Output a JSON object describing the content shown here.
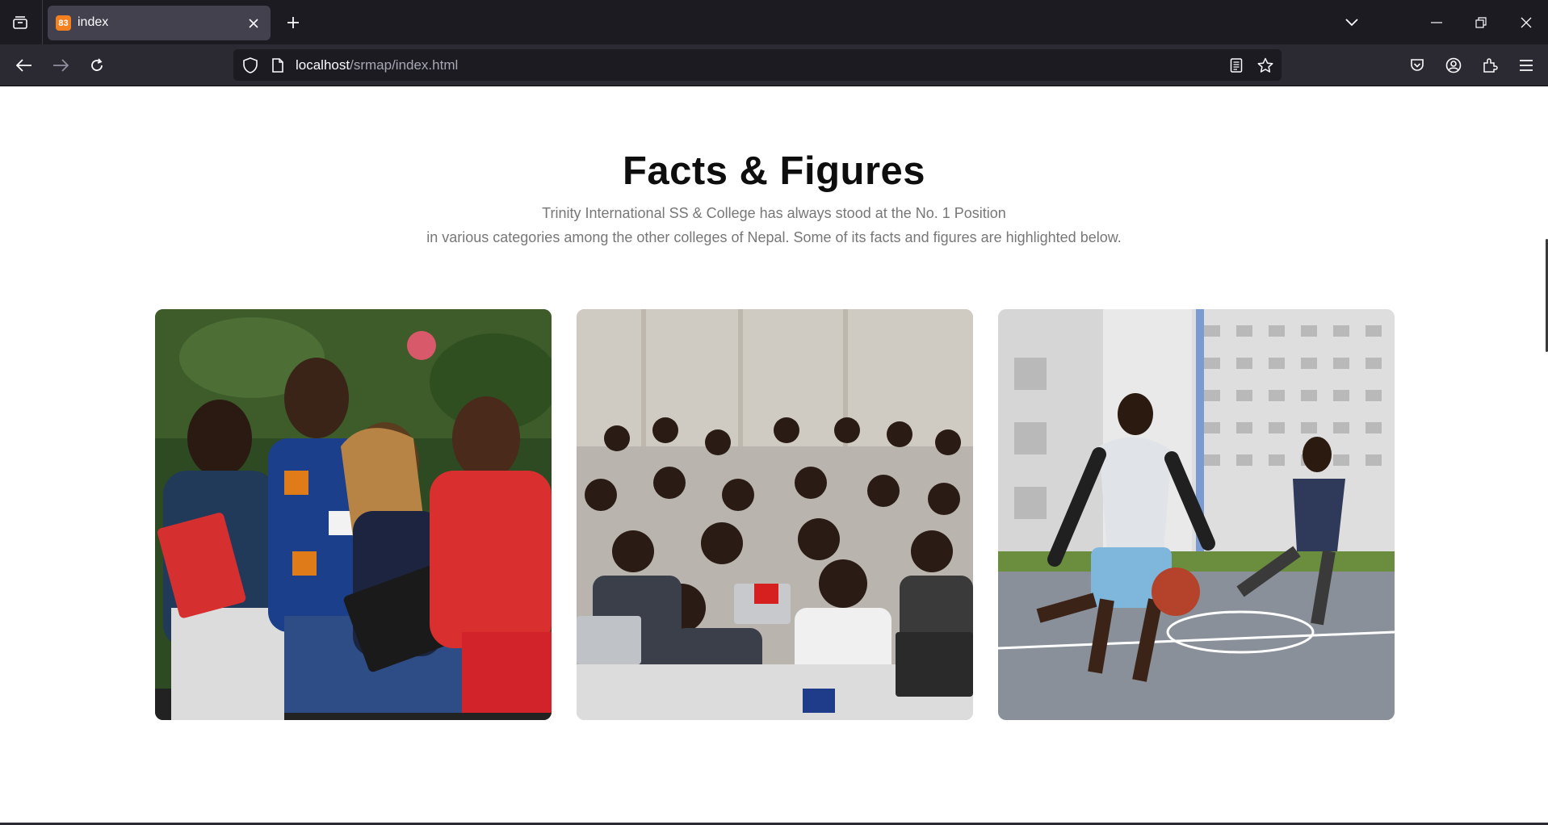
{
  "browser": {
    "tab_title": "index",
    "favicon_text": "83",
    "url_host": "localhost",
    "url_path": "/srmap/index.html"
  },
  "icons": {
    "tab_list": "tab-list-icon",
    "close_tab": "close-icon",
    "new_tab": "plus-icon",
    "tabs_dropdown": "chevron-down-icon",
    "minimize": "minimize-icon",
    "restore": "restore-icon",
    "close_window": "close-icon",
    "back": "back-arrow-icon",
    "forward": "forward-arrow-icon",
    "reload": "reload-icon",
    "shield": "shield-icon",
    "page": "page-icon",
    "reader": "reader-view-icon",
    "bookmark": "star-icon",
    "pocket": "pocket-icon",
    "account": "account-icon",
    "extensions": "extensions-icon",
    "menu": "hamburger-menu-icon"
  },
  "section": {
    "title": "Facts & Figures",
    "subtitle_line1": "Trinity International SS & College has always stood at the No. 1 Position",
    "subtitle_line2": "in various categories among the other colleges of Nepal. Some of its facts and figures are highlighted below."
  },
  "cards": [
    {
      "alt": "Students sitting together outdoors with laptop and books"
    },
    {
      "alt": "Students in a lecture hall with laptops"
    },
    {
      "alt": "Students playing basketball on campus court"
    }
  ]
}
